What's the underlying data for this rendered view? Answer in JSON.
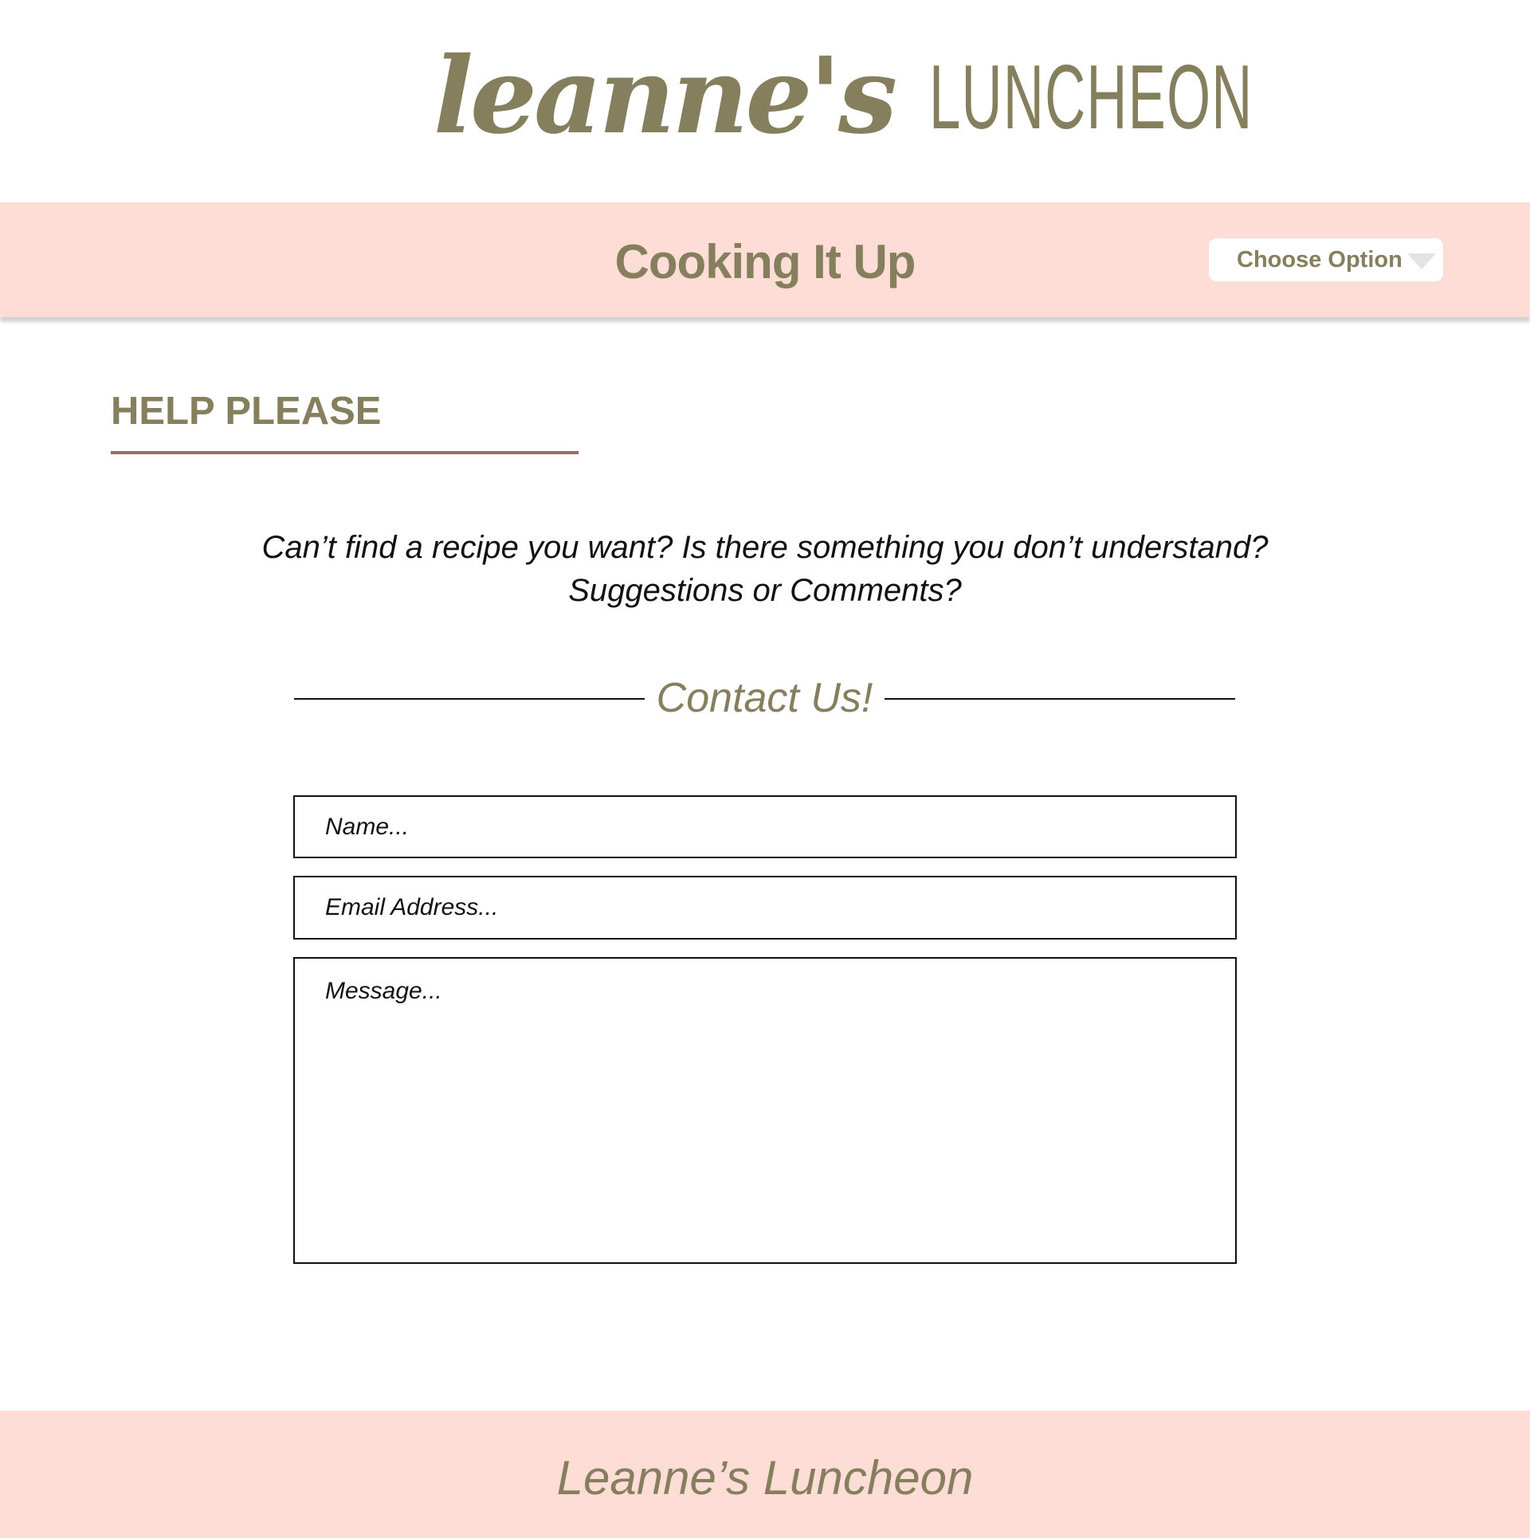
{
  "logo": {
    "script": "leanne's",
    "caps": "LUNCHEON"
  },
  "navbar": {
    "title": "Cooking It Up",
    "dropdown_label": "Choose Option"
  },
  "section": {
    "heading": "HELP PLEASE"
  },
  "intro": {
    "line1": "Can’t find a recipe you want? Is there something you don’t understand?",
    "line2": "Suggestions or Comments?"
  },
  "contact": {
    "title": "Contact Us!",
    "name_placeholder": "Name...",
    "email_placeholder": "Email Address...",
    "message_placeholder": "Message..."
  },
  "footer": {
    "text": "Leanne’s Luncheon"
  },
  "colors": {
    "brand_olive": "#857f5e",
    "pink_band": "#ffddd7",
    "heading_rule": "#9c6b69"
  }
}
